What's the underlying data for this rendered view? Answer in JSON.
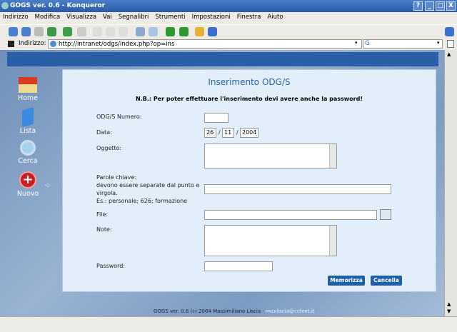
{
  "window": {
    "title": "GOGS ver. 0.6 - Konqueror"
  },
  "menu": [
    "Indirizzo",
    "Modifica",
    "Visualizza",
    "Vai",
    "Segnalibri",
    "Strumenti",
    "Impostazioni",
    "Finestra",
    "Aiuto"
  ],
  "location": {
    "label": "Indirizzo:",
    "url": "http://intranet/odgs/index.php?op=ins"
  },
  "sidebar": [
    {
      "label": "Home",
      "icon": "home-icon"
    },
    {
      "label": "Lista",
      "icon": "book-icon"
    },
    {
      "label": "Cerca",
      "icon": "magnifier-icon"
    },
    {
      "label": "Nuovo",
      "icon": "plus-icon"
    }
  ],
  "form": {
    "title": "Inserimento ODG/S",
    "note": "N.B.: Per poter effettuare l'inserimento devi avere anche la password!",
    "numero_label": "ODG/S Numero:",
    "numero_value": "",
    "data_label": "Data:",
    "day": "26",
    "month": "11",
    "year": "2004",
    "sep": "/",
    "oggetto_label": "Oggetto:",
    "parole_label1": "Parole chiave:",
    "parole_label2": "devono essere separate dal punto e",
    "parole_label3": "virgola.",
    "parole_label4": "Es.: personale; 626; formazione",
    "file_label": "File:",
    "note_label": "Note:",
    "password_label": "Password:",
    "save": "Memorizza",
    "cancel": "Cancella"
  },
  "footer": {
    "text": "GOGS ver. 0.6 (c) 2004 Massimiliano Liscia - ",
    "email": "maxliscia@ccfnet.it"
  },
  "colors": {
    "accent": "#1f5fa8",
    "panel": "#e2effb",
    "title": "#2a5fa8"
  }
}
